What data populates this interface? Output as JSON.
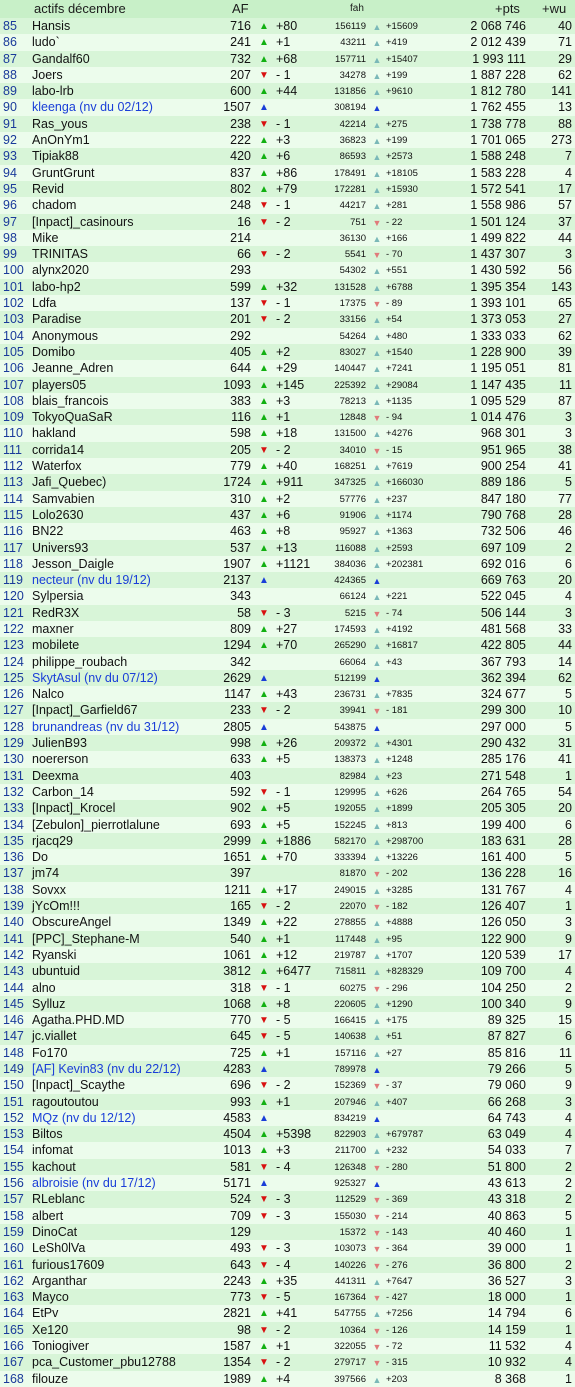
{
  "headers": {
    "title": "actifs décembre",
    "af": "AF",
    "fah": "fah",
    "pts": "+pts",
    "wu": "+wu"
  },
  "rows": [
    [
      "85",
      "Hansis",
      "716",
      "up",
      "+80",
      "156119",
      "up",
      "+15609",
      "2 068 746",
      "40"
    ],
    [
      "86",
      "ludo`",
      "241",
      "up",
      "+1",
      "43211",
      "up",
      "+419",
      "2 012 439",
      "71"
    ],
    [
      "87",
      "Gandalf60",
      "732",
      "up",
      "+68",
      "157711",
      "up",
      "+15407",
      "1 993 111",
      "29"
    ],
    [
      "88",
      "Joers",
      "207",
      "down",
      "- 1",
      "34278",
      "up",
      "+199",
      "1 887 228",
      "62"
    ],
    [
      "89",
      "labo-lrb",
      "600",
      "up",
      "+44",
      "131856",
      "up",
      "+9610",
      "1 812 780",
      "141"
    ],
    [
      "90",
      "kleenga  (nv du 02/12)",
      "1507",
      "new",
      "",
      "308194",
      "new",
      "",
      "1 762 455",
      "13"
    ],
    [
      "91",
      "Ras_yous",
      "238",
      "down",
      "- 1",
      "42214",
      "up",
      "+275",
      "1 738 778",
      "88"
    ],
    [
      "92",
      "AnOnYm1",
      "222",
      "up",
      "+3",
      "36823",
      "up",
      "+199",
      "1 701 065",
      "273"
    ],
    [
      "93",
      "Tipiak88",
      "420",
      "up",
      "+6",
      "86593",
      "up",
      "+2573",
      "1 588 248",
      "7"
    ],
    [
      "94",
      "GruntGrunt",
      "837",
      "up",
      "+86",
      "178491",
      "up",
      "+18105",
      "1 583 228",
      "4"
    ],
    [
      "95",
      "Revid",
      "802",
      "up",
      "+79",
      "172281",
      "up",
      "+15930",
      "1 572 541",
      "17"
    ],
    [
      "96",
      "chadom",
      "248",
      "down",
      "- 1",
      "44217",
      "up",
      "+281",
      "1 558 986",
      "57"
    ],
    [
      "97",
      "[Inpact]_casinours",
      "16",
      "down",
      "- 2",
      "751",
      "down",
      "- 22",
      "1 501 124",
      "37"
    ],
    [
      "98",
      "Mike",
      "214",
      "",
      "",
      "36130",
      "up",
      "+166",
      "1 499 822",
      "44"
    ],
    [
      "99",
      "TRINITAS",
      "66",
      "down",
      "- 2",
      "5541",
      "down",
      "- 70",
      "1 437 307",
      "3"
    ],
    [
      "100",
      "alynx2020",
      "293",
      "",
      "",
      "54302",
      "up",
      "+551",
      "1 430 592",
      "56"
    ],
    [
      "101",
      "labo-hp2",
      "599",
      "up",
      "+32",
      "131528",
      "up",
      "+6788",
      "1 395 354",
      "143"
    ],
    [
      "102",
      "Ldfa",
      "137",
      "down",
      "- 1",
      "17375",
      "down",
      "- 89",
      "1 393 101",
      "65"
    ],
    [
      "103",
      "Paradise",
      "201",
      "down",
      "- 2",
      "33156",
      "up",
      "+54",
      "1 373 053",
      "27"
    ],
    [
      "104",
      "Anonymous",
      "292",
      "",
      "",
      "54264",
      "up",
      "+480",
      "1 333 033",
      "62"
    ],
    [
      "105",
      "Domibo",
      "405",
      "up",
      "+2",
      "83027",
      "up",
      "+1540",
      "1 228 900",
      "39"
    ],
    [
      "106",
      "Jeanne_Adren",
      "644",
      "up",
      "+29",
      "140447",
      "up",
      "+7241",
      "1 195 051",
      "81"
    ],
    [
      "107",
      "players05",
      "1093",
      "up",
      "+145",
      "225392",
      "up",
      "+29084",
      "1 147 435",
      "11"
    ],
    [
      "108",
      "blais_francois",
      "383",
      "up",
      "+3",
      "78213",
      "up",
      "+1135",
      "1 095 529",
      "87"
    ],
    [
      "109",
      "TokyoQuaSaR",
      "116",
      "up",
      "+1",
      "12848",
      "down",
      "- 94",
      "1 014 476",
      "3"
    ],
    [
      "110",
      "hakland",
      "598",
      "up",
      "+18",
      "131500",
      "up",
      "+4276",
      "968 301",
      "3"
    ],
    [
      "111",
      "corrida14",
      "205",
      "down",
      "- 2",
      "34010",
      "down",
      "- 15",
      "951 965",
      "38"
    ],
    [
      "112",
      "Waterfox",
      "779",
      "up",
      "+40",
      "168251",
      "up",
      "+7619",
      "900 254",
      "41"
    ],
    [
      "113",
      "Jafi_Quebec)",
      "1724",
      "up",
      "+911",
      "347325",
      "up",
      "+166030",
      "889 186",
      "5"
    ],
    [
      "114",
      "Samvabien",
      "310",
      "up",
      "+2",
      "57776",
      "up",
      "+237",
      "847 180",
      "77"
    ],
    [
      "115",
      "Lolo2630",
      "437",
      "up",
      "+6",
      "91906",
      "up",
      "+1174",
      "790 768",
      "28"
    ],
    [
      "116",
      "BN22",
      "463",
      "up",
      "+8",
      "95927",
      "up",
      "+1363",
      "732 506",
      "46"
    ],
    [
      "117",
      "Univers93",
      "537",
      "up",
      "+13",
      "116088",
      "up",
      "+2593",
      "697 109",
      "2"
    ],
    [
      "118",
      "Jesson_Daigle",
      "1907",
      "up",
      "+1121",
      "384036",
      "up",
      "+202381",
      "692 016",
      "6"
    ],
    [
      "119",
      "necteur  (nv du 19/12)",
      "2137",
      "new",
      "",
      "424365",
      "new",
      "",
      "669 763",
      "20"
    ],
    [
      "120",
      "Sylpersia",
      "343",
      "",
      "",
      "66124",
      "up",
      "+221",
      "522 045",
      "4"
    ],
    [
      "121",
      "RedR3X",
      "58",
      "down",
      "- 3",
      "5215",
      "down",
      "- 74",
      "506 144",
      "3"
    ],
    [
      "122",
      "maxner",
      "809",
      "up",
      "+27",
      "174593",
      "up",
      "+4192",
      "481 568",
      "33"
    ],
    [
      "123",
      "mobilete",
      "1294",
      "up",
      "+70",
      "265290",
      "up",
      "+16817",
      "422 805",
      "44"
    ],
    [
      "124",
      "philippe_roubach",
      "342",
      "",
      "",
      "66064",
      "up",
      "+43",
      "367 793",
      "14"
    ],
    [
      "125",
      "SkytAsul  (nv du 07/12)",
      "2629",
      "new",
      "",
      "512199",
      "new",
      "",
      "362 394",
      "62"
    ],
    [
      "126",
      "Nalco",
      "1147",
      "up",
      "+43",
      "236731",
      "up",
      "+7835",
      "324 677",
      "5"
    ],
    [
      "127",
      "[Inpact]_Garfield67",
      "233",
      "down",
      "- 2",
      "39941",
      "down",
      "- 181",
      "299 300",
      "10"
    ],
    [
      "128",
      "brunandreas  (nv du 31/12)",
      "2805",
      "new",
      "",
      "543875",
      "new",
      "",
      "297 000",
      "5"
    ],
    [
      "129",
      "JulienB93",
      "998",
      "up",
      "+26",
      "209372",
      "up",
      "+4301",
      "290 432",
      "31"
    ],
    [
      "130",
      "noererson",
      "633",
      "up",
      "+5",
      "138373",
      "up",
      "+1248",
      "285 176",
      "41"
    ],
    [
      "131",
      "Deexma",
      "403",
      "",
      "",
      "82984",
      "up",
      "+23",
      "271 548",
      "1"
    ],
    [
      "132",
      "Carbon_14",
      "592",
      "down",
      "- 1",
      "129995",
      "up",
      "+626",
      "264 765",
      "54"
    ],
    [
      "133",
      "[Inpact]_Krocel",
      "902",
      "up",
      "+5",
      "192055",
      "up",
      "+1899",
      "205 305",
      "20"
    ],
    [
      "134",
      "[Zebulon]_pierrotlalune",
      "693",
      "up",
      "+5",
      "152245",
      "up",
      "+813",
      "199 400",
      "6"
    ],
    [
      "135",
      "rjacq29",
      "2999",
      "up",
      "+1886",
      "582170",
      "up",
      "+298700",
      "183 631",
      "28"
    ],
    [
      "136",
      "Do",
      "1651",
      "up",
      "+70",
      "333394",
      "up",
      "+13226",
      "161 400",
      "5"
    ],
    [
      "137",
      "jm74",
      "397",
      "",
      "",
      "81870",
      "down",
      "- 202",
      "136 228",
      "16"
    ],
    [
      "138",
      "Sovxx",
      "1211",
      "up",
      "+17",
      "249015",
      "up",
      "+3285",
      "131 767",
      "4"
    ],
    [
      "139",
      "jYcOm!!!",
      "165",
      "down",
      "- 2",
      "22070",
      "down",
      "- 182",
      "126 407",
      "1"
    ],
    [
      "140",
      "ObscureAngel",
      "1349",
      "up",
      "+22",
      "278855",
      "up",
      "+4888",
      "126 050",
      "3"
    ],
    [
      "141",
      "[PPC]_Stephane-M",
      "540",
      "up",
      "+1",
      "117448",
      "up",
      "+95",
      "122 900",
      "9"
    ],
    [
      "142",
      "Ryanski",
      "1061",
      "up",
      "+12",
      "219787",
      "up",
      "+1707",
      "120 539",
      "17"
    ],
    [
      "143",
      "ubuntuid",
      "3812",
      "up",
      "+6477",
      "715811",
      "up",
      "+828329",
      "109 700",
      "4"
    ],
    [
      "144",
      "alno",
      "318",
      "down",
      "- 1",
      "60275",
      "down",
      "- 296",
      "104 250",
      "2"
    ],
    [
      "145",
      "Sylluz",
      "1068",
      "up",
      "+8",
      "220605",
      "up",
      "+1290",
      "100 340",
      "9"
    ],
    [
      "146",
      "Agatha.PHD.MD",
      "770",
      "down",
      "- 5",
      "166415",
      "up",
      "+175",
      "89 325",
      "15"
    ],
    [
      "147",
      "jc.viallet",
      "645",
      "down",
      "- 5",
      "140638",
      "up",
      "+51",
      "87 827",
      "6"
    ],
    [
      "148",
      "Fo170",
      "725",
      "up",
      "+1",
      "157116",
      "up",
      "+27",
      "85 816",
      "11"
    ],
    [
      "149",
      "[AF] Kevin83  (nv du 22/12)",
      "4283",
      "new",
      "",
      "789978",
      "new",
      "",
      "79 266",
      "5"
    ],
    [
      "150",
      "[Inpact]_Scaythe",
      "696",
      "down",
      "- 2",
      "152369",
      "down",
      "- 37",
      "79 060",
      "9"
    ],
    [
      "151",
      "ragoutoutou",
      "993",
      "up",
      "+1",
      "207946",
      "up",
      "+407",
      "66 268",
      "3"
    ],
    [
      "152",
      "MQz  (nv du 12/12)",
      "4583",
      "new",
      "",
      "834219",
      "new",
      "",
      "64 743",
      "4"
    ],
    [
      "153",
      "Biltos",
      "4504",
      "up",
      "+5398",
      "822903",
      "up",
      "+679787",
      "63 049",
      "4"
    ],
    [
      "154",
      "infomat",
      "1013",
      "up",
      "+3",
      "211700",
      "up",
      "+232",
      "54 033",
      "7"
    ],
    [
      "155",
      "kachout",
      "581",
      "down",
      "- 4",
      "126348",
      "down",
      "- 280",
      "51 800",
      "2"
    ],
    [
      "156",
      "albroisie  (nv du 17/12)",
      "5171",
      "new",
      "",
      "925327",
      "new",
      "",
      "43 613",
      "2"
    ],
    [
      "157",
      "RLeblanc",
      "524",
      "down",
      "- 3",
      "112529",
      "down",
      "- 369",
      "43 318",
      "2"
    ],
    [
      "158",
      "albert",
      "709",
      "down",
      "- 3",
      "155030",
      "down",
      "- 214",
      "40 863",
      "5"
    ],
    [
      "159",
      "DinoCat",
      "129",
      "",
      "",
      "15372",
      "down",
      "- 143",
      "40 460",
      "1"
    ],
    [
      "160",
      "LeSh0lVa",
      "493",
      "down",
      "- 3",
      "103073",
      "down",
      "- 364",
      "39 000",
      "1"
    ],
    [
      "161",
      "furious17609",
      "643",
      "down",
      "- 4",
      "140226",
      "down",
      "- 276",
      "36 800",
      "2"
    ],
    [
      "162",
      "Arganthar",
      "2243",
      "up",
      "+35",
      "441311",
      "up",
      "+7647",
      "36 527",
      "3"
    ],
    [
      "163",
      "Mayco",
      "773",
      "down",
      "- 5",
      "167364",
      "down",
      "- 427",
      "18 000",
      "1"
    ],
    [
      "164",
      "EtPv",
      "2821",
      "up",
      "+41",
      "547755",
      "up",
      "+7256",
      "14 794",
      "6"
    ],
    [
      "165",
      "Xe120",
      "98",
      "down",
      "- 2",
      "10364",
      "down",
      "- 126",
      "14 159",
      "1"
    ],
    [
      "166",
      "Toniogiver",
      "1587",
      "up",
      "+1",
      "322055",
      "down",
      "- 72",
      "11 532",
      "4"
    ],
    [
      "167",
      "pca_Customer_pbu12788",
      "1354",
      "down",
      "- 2",
      "279717",
      "down",
      "- 315",
      "10 932",
      "4"
    ],
    [
      "168",
      "filouze",
      "1989",
      "up",
      "+4",
      "397566",
      "up",
      "+203",
      "8 368",
      "1"
    ]
  ]
}
